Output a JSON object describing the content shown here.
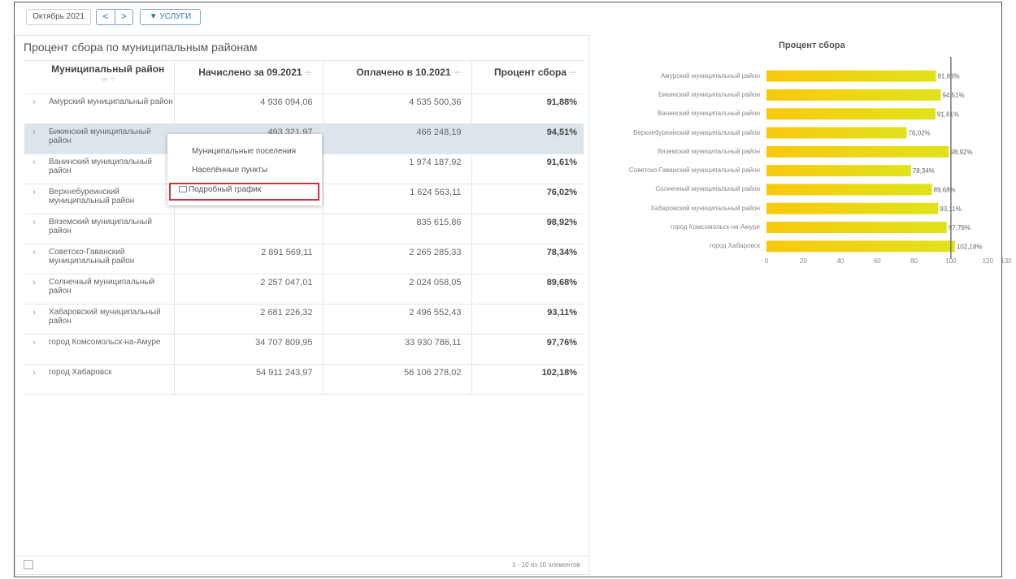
{
  "toolbar": {
    "month": "Октябрь 2021",
    "prev": "<",
    "next": ">",
    "services": "▼ УСЛУГИ"
  },
  "panel": {
    "title": "Процент сбора по муниципальным районам",
    "columns": [
      {
        "label": "Муниципальный район",
        "sort": "⌯ ▿"
      },
      {
        "label": "Начислено за 09.2021",
        "sort": "⌯"
      },
      {
        "label": "Оплачено в 10.2021",
        "sort": "⌯"
      },
      {
        "label": "Процент сбора",
        "sort": "⌯"
      }
    ],
    "rows": [
      {
        "name": "Амурский муниципальный район",
        "charged": "4 936 094,06",
        "paid": "4 535 500,36",
        "pct": "91,88%"
      },
      {
        "name": "Бикинский муниципальный район",
        "charged": "493 321,97",
        "paid": "466 248,19",
        "pct": "94,51%"
      },
      {
        "name": "Ванинский муниципальный район",
        "charged": "",
        "paid": "1 974 187,92",
        "pct": "91,61%"
      },
      {
        "name": "Верхнебуреинский муниципальный район",
        "charged": "",
        "paid": "1 624 563,11",
        "pct": "76,02%"
      },
      {
        "name": "Вяземский муниципальный район",
        "charged": "",
        "paid": "835 615,86",
        "pct": "98,92%"
      },
      {
        "name": "Советско-Гаванский муниципальный район",
        "charged": "2 891 569,11",
        "paid": "2 265 285,33",
        "pct": "78,34%"
      },
      {
        "name": "Солнечный муниципальный район",
        "charged": "2 257 047,01",
        "paid": "2 024 058,05",
        "pct": "89,68%"
      },
      {
        "name": "Хабаровский муниципальный район",
        "charged": "2 681 226,32",
        "paid": "2 496 552,43",
        "pct": "93,11%"
      },
      {
        "name": "город Комсомольск-на-Амуре",
        "charged": "34 707 809,95",
        "paid": "33 930 786,11",
        "pct": "97,76%"
      },
      {
        "name": "город Хабаровск",
        "charged": "54 911 243,97",
        "paid": "56 106 278,02",
        "pct": "102,18%"
      }
    ],
    "footer": "1 - 10 из 10 элементов"
  },
  "context_menu": {
    "items": [
      "Муниципальные поселения",
      "Населённые пункты",
      "Подробный график"
    ]
  },
  "colors": {
    "bar_start": "#f9c80e",
    "bar_end": "#e0e31c",
    "selected_row": "#dde5ec",
    "highlight": "#d2323c"
  },
  "chart_data": {
    "type": "bar",
    "orientation": "horizontal",
    "title": "Процент сбора",
    "categories": [
      "Амурский муниципальный район",
      "Бикинский муниципальный район",
      "Ванинский муниципальный район",
      "Верхнебуреинский муниципальный район",
      "Вяземский муниципальный район",
      "Советско-Гаванский муниципальный район",
      "Солнечный муниципальный район",
      "Хабаровский муниципальный район",
      "город Комсомольск-на-Амуре",
      "город Хабаровск"
    ],
    "values": [
      91.88,
      94.51,
      91.61,
      76.02,
      98.92,
      78.34,
      89.68,
      93.11,
      97.76,
      102.18
    ],
    "labels": [
      "91,88%",
      "94,51%",
      "91,61%",
      "76,02%",
      "98,92%",
      "78,34%",
      "89,68%",
      "93,11%",
      "97,76%",
      "102,18%"
    ],
    "xlim": [
      0,
      130
    ],
    "xticks": [
      "0",
      "20",
      "40",
      "60",
      "80",
      "100",
      "120",
      "130"
    ],
    "xtick_values": [
      0,
      20,
      40,
      60,
      80,
      100,
      120,
      130
    ],
    "reference_line": 100
  }
}
